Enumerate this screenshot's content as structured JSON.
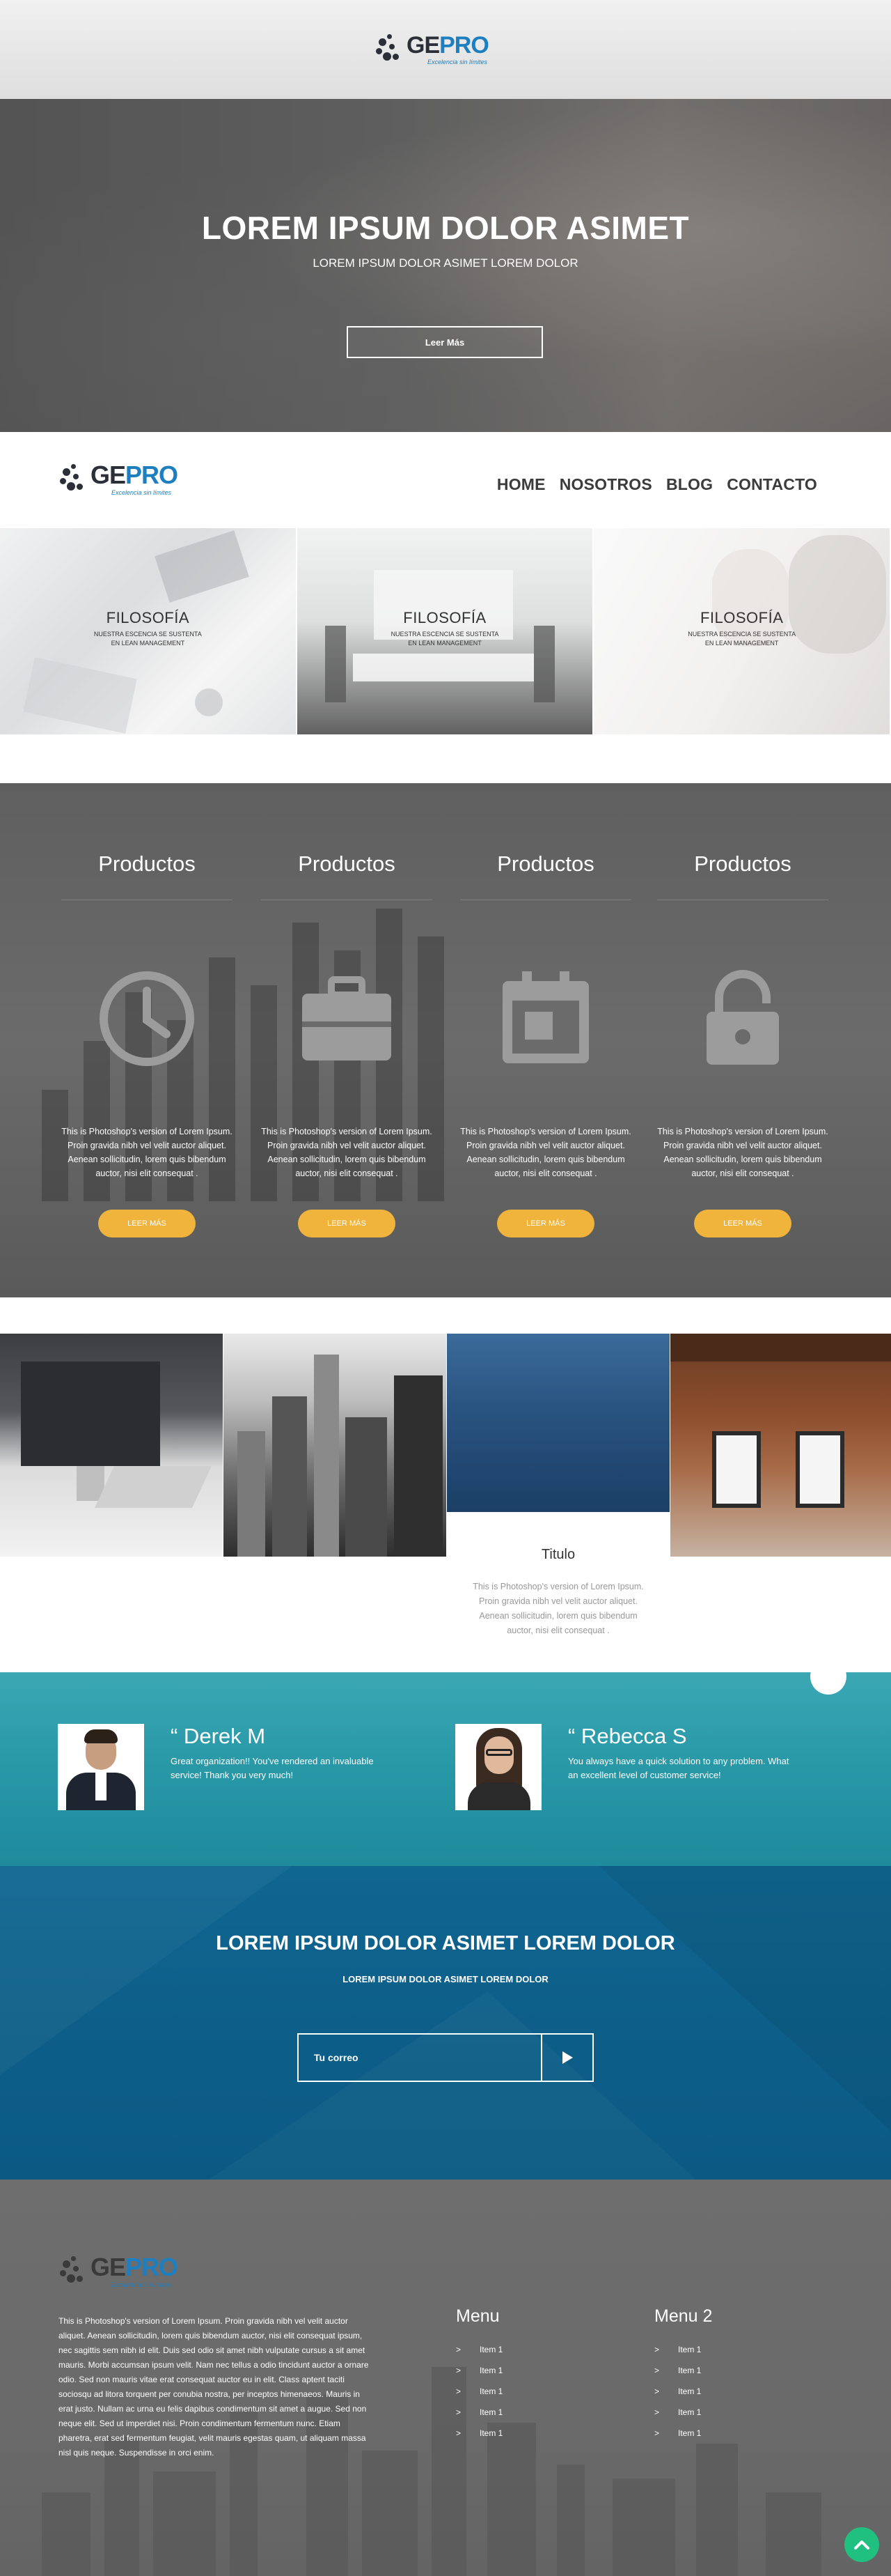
{
  "brand": {
    "name_dark": "GE",
    "name_blue": "PRO",
    "tagline": "Excelencia sin límites"
  },
  "hero": {
    "title": "LOREM IPSUM DOLOR ASIMET",
    "subtitle": "LOREM IPSUM DOLOR ASIMET LOREM DOLOR",
    "button": "Leer Más"
  },
  "nav": {
    "items": [
      "HOME",
      "NOSOTROS",
      "BLOG",
      "CONTACTO"
    ]
  },
  "tiles": [
    {
      "title": "FILOSOFÍA",
      "line1": "NUESTRA ESCENCIA SE SUSTENTA",
      "line2": "EN LEAN MANAGEMENT"
    },
    {
      "title": "FILOSOFÍA",
      "line1": "NUESTRA ESCENCIA SE SUSTENTA",
      "line2": "EN LEAN MANAGEMENT"
    },
    {
      "title": "FILOSOFÍA",
      "line1": "NUESTRA ESCENCIA SE SUSTENTA",
      "line2": "EN LEAN MANAGEMENT"
    }
  ],
  "products": [
    {
      "title": "Productos",
      "icon": "clock-icon",
      "lines": [
        "This is Photoshop's version  of Lorem Ipsum.",
        "Proin gravida nibh vel velit auctor aliquet.",
        "Aenean sollicitudin, lorem quis bibendum",
        "auctor, nisi elit consequat ."
      ],
      "button": "LEER MÁS"
    },
    {
      "title": "Productos",
      "icon": "briefcase-icon",
      "lines": [
        "This is Photoshop's version  of Lorem Ipsum.",
        "Proin gravida nibh vel velit auctor aliquet.",
        "Aenean sollicitudin, lorem quis bibendum",
        "auctor, nisi elit consequat ."
      ],
      "button": "LEER MÁS"
    },
    {
      "title": "Productos",
      "icon": "calendar-icon",
      "lines": [
        "This is Photoshop's version  of Lorem Ipsum.",
        "Proin gravida nibh vel velit auctor aliquet.",
        "Aenean sollicitudin, lorem quis bibendum",
        "auctor, nisi elit consequat ."
      ],
      "button": "LEER MÁS"
    },
    {
      "title": "Productos",
      "icon": "unlock-icon",
      "lines": [
        "This is Photoshop's version  of Lorem Ipsum.",
        "Proin gravida nibh vel velit auctor aliquet.",
        "Aenean sollicitudin, lorem quis bibendum",
        "auctor, nisi elit consequat ."
      ],
      "button": "LEER MÁS"
    }
  ],
  "gallery": {
    "caption_title": "Titulo",
    "caption_lines": [
      "This is Photoshop's version  of Lorem Ipsum.",
      "Proin gravida nibh vel velit auctor aliquet.",
      "Aenean sollicitudin, lorem quis bibendum",
      "auctor, nisi elit consequat ."
    ]
  },
  "testimonials": [
    {
      "name": "“ Derek M",
      "quote": "Great organization!! You've rendered an invaluable service! Thank you very much!"
    },
    {
      "name": "“ Rebecca S",
      "quote": "You always have a quick solution to any problem. What an excellent level of customer service!"
    }
  ],
  "newsletter": {
    "title": "LOREM IPSUM DOLOR ASIMET LOREM DOLOR",
    "subtitle": "LOREM IPSUM DOLOR ASIMET LOREM DOLOR",
    "input_label": "Tu correo"
  },
  "footer": {
    "about_lines": [
      "This is Photoshop's version  of Lorem Ipsum. Proin gravida nibh vel velit auctor",
      "aliquet. Aenean sollicitudin, lorem quis bibendum auctor, nisi elit consequat ipsum,",
      "nec sagittis sem nibh id elit. Duis sed odio sit amet nibh vulputate cursus a sit amet",
      "mauris. Morbi accumsan ipsum velit. Nam nec tellus a odio tincidunt auctor a ornare",
      "odio. Sed non  mauris vitae erat consequat auctor eu in elit. Class aptent taciti",
      "sociosqu ad litora torquent per conubia nostra, per inceptos himenaeos. Mauris in",
      "erat justo. Nullam ac urna eu felis dapibus condimentum sit amet a augue. Sed non",
      "neque elit. Sed ut imperdiet nisi. Proin condimentum fermentum nunc. Etiam",
      "pharetra, erat sed fermentum feugiat, velit mauris egestas quam, ut aliquam massa",
      "nisl quis neque. Suspendisse in orci enim."
    ],
    "menus": [
      {
        "title": "Menu",
        "items": [
          "Item 1",
          "Item 1",
          "Item 1",
          "Item 1",
          "Item 1"
        ]
      },
      {
        "title": "Menu 2",
        "items": [
          "Item 1",
          "Item 1",
          "Item 1",
          "Item 1",
          "Item 1"
        ]
      }
    ],
    "arrow": ">"
  },
  "colors": {
    "brand_blue": "#1d7fbf",
    "accent_yellow": "#f0b43c",
    "teal": "#1f93a3",
    "deep_blue": "#0d5f89",
    "scroll_green": "#20c081"
  }
}
